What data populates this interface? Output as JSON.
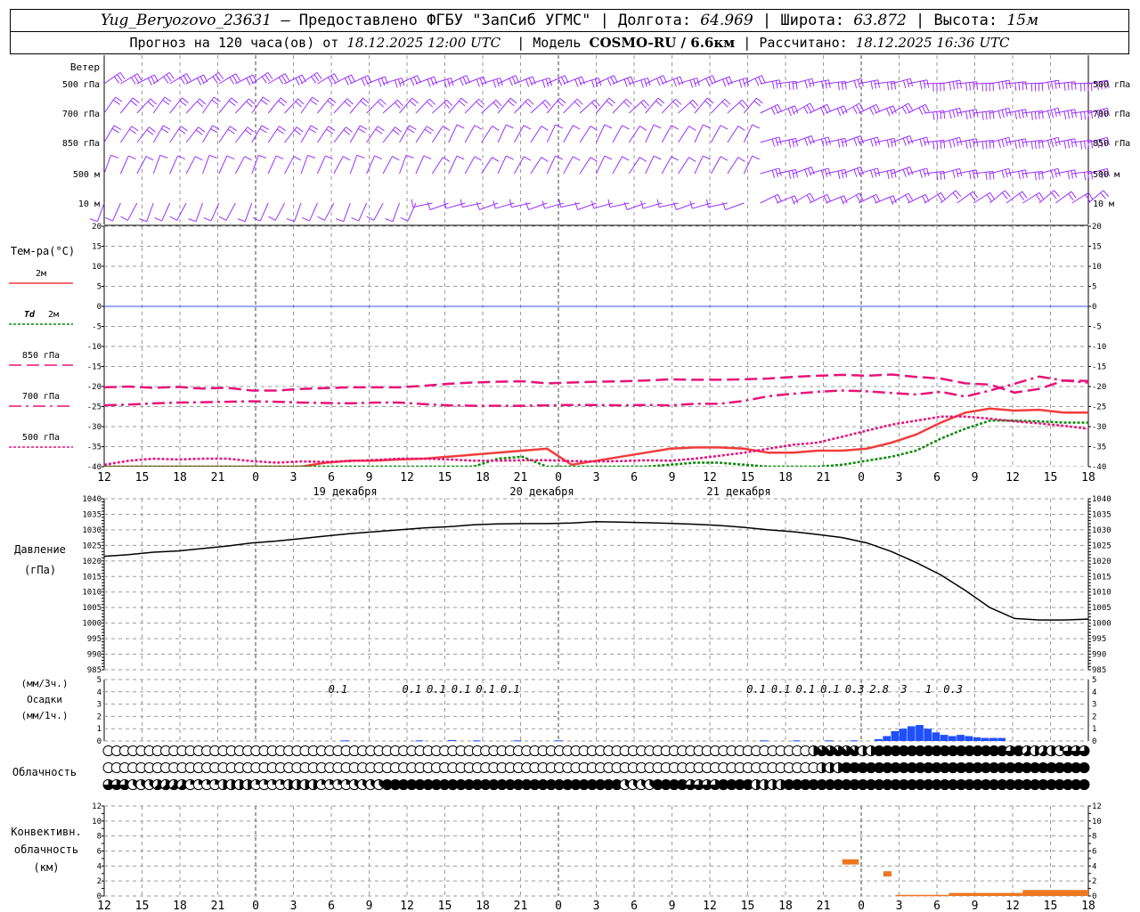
{
  "header": {
    "station": "Yug_Beryozovo_23631",
    "provider": "– Предоставлено ФГБУ \"ЗапСиб УГМС\"",
    "lon_label": "Долгота:",
    "lon": "64.969",
    "lat_label": "Широта:",
    "lat": "63.872",
    "alt_label": "Высота:",
    "alt": "15м",
    "forecast_label": "Прогноз на 120 часа(ов) от",
    "forecast_start": "18.12.2025 12:00 UTC",
    "model_label": "Модель",
    "model": "COSMO-RU / 6.6км",
    "calc_label": "Рассчитано:",
    "calc_time": "18.12.2025 16:36 UTC"
  },
  "colors": {
    "wind": "#9b30ff",
    "t2m": "#f23c3c",
    "td2m": "#0a8a0a",
    "t850": "#e8127a",
    "t700": "#e8127a",
    "t500": "#e8127a",
    "zero_line": "#3355ff",
    "pressure": "#000000",
    "precip": "#1f4fff",
    "convective": "#ee7722",
    "grid": "#9a9a9a"
  },
  "x_axis": {
    "ticks": [
      "12",
      "15",
      "18",
      "21",
      "0",
      "3",
      "6",
      "9",
      "12",
      "15",
      "18",
      "21",
      "0",
      "3",
      "6",
      "9",
      "12",
      "15",
      "18",
      "21",
      "0",
      "3",
      "6",
      "9",
      "12",
      "15",
      "18"
    ],
    "days": [
      "19 декабря",
      "20 декабря",
      "21 декабря"
    ]
  },
  "panels": {
    "wind": {
      "title": "Ветер",
      "levels": [
        "500 гПа",
        "700 гПа",
        "850 гПа",
        "500 м",
        "10 м"
      ]
    },
    "temp": {
      "title": "Тем-ра(°C)",
      "legend": [
        {
          "prefix": "",
          "label": "2м"
        },
        {
          "prefix": "Td",
          "label": "2м"
        },
        {
          "prefix": "",
          "label": "850 гПа"
        },
        {
          "prefix": "",
          "label": "700 гПа"
        },
        {
          "prefix": "",
          "label": "500 гПа"
        }
      ]
    },
    "pressure": {
      "title": "Давление",
      "unit": "(гПа)"
    },
    "precip": {
      "unit3": "(мм/3ч.)",
      "title": "Осадки",
      "unit1": "(мм/1ч.)"
    },
    "cloud": {
      "title": "Облачность"
    },
    "convective": {
      "title1": "Конвективн.",
      "title2": "облачность",
      "unit": "(км)"
    }
  },
  "chart_data": [
    {
      "type": "line",
      "name": "temperature",
      "x_hours": [
        0,
        3,
        6,
        9,
        12,
        15,
        18,
        21,
        24,
        27,
        30,
        33,
        36,
        39,
        42,
        45,
        48,
        51,
        54,
        57,
        60,
        63,
        66,
        69,
        72,
        75,
        78,
        81,
        84,
        87,
        90,
        93,
        96,
        99,
        102,
        105,
        108,
        111,
        114,
        117,
        120
      ],
      "ylim": [
        -40,
        20
      ],
      "yticks": [
        20,
        15,
        10,
        5,
        0,
        -5,
        -10,
        -15,
        -20,
        -25,
        -30,
        -35,
        -40
      ],
      "series": [
        {
          "key": "t2m",
          "values": [
            -42,
            -42,
            -42,
            -42,
            -42,
            -42,
            -41.5,
            -41,
            -40,
            -39,
            -38.5,
            -38.5,
            -38.2,
            -38,
            -37.5,
            -37,
            -36.5,
            -36,
            -35.5,
            -39.5,
            -38.5,
            -37.5,
            -36.5,
            -35.5,
            -35.2,
            -35.2,
            -35.5,
            -36.5,
            -36.5,
            -36,
            -36,
            -35.5,
            -34,
            -32,
            -29,
            -26.5,
            -25.5,
            -26,
            -25.8,
            -26.5,
            -26.5
          ]
        },
        {
          "key": "td2m",
          "values": [
            -44,
            -44,
            -44,
            -44,
            -44,
            -44,
            -44,
            -44,
            -44,
            -44,
            -44,
            -44,
            -44,
            -44,
            -43,
            -40,
            -38,
            -37.5,
            -40,
            -44,
            -44,
            -44,
            -41,
            -39.5,
            -39,
            -39,
            -39.5,
            -40,
            -40,
            -40,
            -39.5,
            -38.5,
            -37.5,
            -36,
            -33,
            -30.5,
            -28.5,
            -28.5,
            -28.7,
            -29,
            -29
          ]
        },
        {
          "key": "t850",
          "values": [
            -20.2,
            -20,
            -20.3,
            -20.1,
            -20.5,
            -20.3,
            -21,
            -21,
            -20.6,
            -20.4,
            -20.2,
            -20.2,
            -20.2,
            -19.8,
            -19.3,
            -19.0,
            -18.8,
            -18.7,
            -19.2,
            -19.0,
            -18.8,
            -18.7,
            -18.5,
            -18.2,
            -18.3,
            -18.3,
            -18.2,
            -18.0,
            -17.6,
            -17.3,
            -17.1,
            -17.3,
            -17.0,
            -17.6,
            -18,
            -19.2,
            -19.5,
            -21.5,
            -20.6,
            -18.5,
            -18.6
          ]
        },
        {
          "key": "t700",
          "values": [
            -24.7,
            -24.5,
            -24.2,
            -24,
            -23.9,
            -23.8,
            -23.7,
            -23.8,
            -24,
            -24.1,
            -24.2,
            -24.0,
            -24.0,
            -24.4,
            -24.7,
            -24.8,
            -24.8,
            -24.8,
            -24.7,
            -24.6,
            -24.6,
            -24.7,
            -24.6,
            -24.7,
            -24.3,
            -24.3,
            -23.6,
            -22.4,
            -21.8,
            -21.3,
            -21.0,
            -21.2,
            -21.6,
            -22.0,
            -21.3,
            -22.5,
            -21.0,
            -19.3,
            -17.5,
            -18.5,
            -19.0
          ]
        },
        {
          "key": "t500",
          "values": [
            -39.5,
            -38.5,
            -38,
            -38.2,
            -38,
            -38,
            -38.6,
            -39,
            -38.7,
            -38.8,
            -38.6,
            -38.3,
            -38.0,
            -38.0,
            -38.2,
            -38.5,
            -38.5,
            -38.4,
            -38.4,
            -38.6,
            -38.7,
            -38.6,
            -38.4,
            -38.5,
            -38.0,
            -37.3,
            -36.5,
            -35.5,
            -34.5,
            -34,
            -32.5,
            -31,
            -29.5,
            -28.5,
            -27.5,
            -27.5,
            -28,
            -28.7,
            -29.2,
            -29.8,
            -30.5
          ]
        }
      ]
    },
    {
      "type": "line",
      "name": "pressure",
      "x_hours": [
        0,
        3,
        6,
        9,
        12,
        15,
        18,
        21,
        24,
        27,
        30,
        33,
        36,
        39,
        42,
        45,
        48,
        51,
        54,
        57,
        60,
        63,
        66,
        69,
        72,
        75,
        78,
        81,
        84,
        87,
        90,
        93,
        96,
        99,
        102,
        105,
        108,
        111,
        114,
        117,
        120
      ],
      "ylim": [
        985,
        1040
      ],
      "yticks": [
        1040,
        1035,
        1030,
        1025,
        1020,
        1015,
        1010,
        1005,
        1000,
        995,
        990,
        985
      ],
      "values": [
        1021.5,
        1022,
        1022.8,
        1023.2,
        1024,
        1024.8,
        1025.8,
        1026.4,
        1027.2,
        1028,
        1028.8,
        1029.4,
        1030,
        1030.6,
        1031,
        1031.6,
        1031.9,
        1032,
        1032,
        1032.2,
        1032.6,
        1032.5,
        1032.3,
        1032.1,
        1031.8,
        1031.4,
        1030.8,
        1030,
        1029.4,
        1028.5,
        1027.5,
        1025.8,
        1023,
        1019.5,
        1015.5,
        1010.5,
        1005,
        1001.5,
        1001,
        1001,
        1001.3
      ]
    },
    {
      "type": "bar",
      "name": "precipitation",
      "ylim": [
        0,
        5
      ],
      "yticks": [
        5,
        4,
        3,
        2,
        1,
        0
      ],
      "labels_3h": [
        {
          "h": 30,
          "v": "0.1"
        },
        {
          "h": 39,
          "v": "0.1"
        },
        {
          "h": 42,
          "v": "0.1"
        },
        {
          "h": 45,
          "v": "0.1"
        },
        {
          "h": 48,
          "v": "0.1"
        },
        {
          "h": 51,
          "v": "0.1"
        },
        {
          "h": 81,
          "v": "0.1"
        },
        {
          "h": 84,
          "v": "0.1"
        },
        {
          "h": 87,
          "v": "0.1"
        },
        {
          "h": 90,
          "v": "0.1"
        },
        {
          "h": 93,
          "v": "0.3"
        },
        {
          "h": 96,
          "v": "2.8"
        },
        {
          "h": 99,
          "v": "3"
        },
        {
          "h": 102,
          "v": "1"
        },
        {
          "h": 105,
          "v": "0.3"
        }
      ],
      "hourly": [
        {
          "h": 29,
          "v": 0.05
        },
        {
          "h": 38,
          "v": 0.05
        },
        {
          "h": 42,
          "v": 0.08
        },
        {
          "h": 45,
          "v": 0.05
        },
        {
          "h": 50,
          "v": 0.05
        },
        {
          "h": 55,
          "v": 0.05
        },
        {
          "h": 80,
          "v": 0.05
        },
        {
          "h": 84,
          "v": 0.05
        },
        {
          "h": 88,
          "v": 0.05
        },
        {
          "h": 91,
          "v": 0.05
        },
        {
          "h": 94,
          "v": 0.15
        },
        {
          "h": 95,
          "v": 0.4
        },
        {
          "h": 96,
          "v": 0.8
        },
        {
          "h": 97,
          "v": 1.0
        },
        {
          "h": 98,
          "v": 1.2
        },
        {
          "h": 99,
          "v": 1.3
        },
        {
          "h": 100,
          "v": 1.0
        },
        {
          "h": 101,
          "v": 0.7
        },
        {
          "h": 102,
          "v": 0.5
        },
        {
          "h": 103,
          "v": 0.4
        },
        {
          "h": 104,
          "v": 0.5
        },
        {
          "h": 105,
          "v": 0.4
        },
        {
          "h": 106,
          "v": 0.3
        },
        {
          "h": 107,
          "v": 0.25
        },
        {
          "h": 108,
          "v": 0.25
        },
        {
          "h": 109,
          "v": 0.25
        }
      ]
    },
    {
      "type": "bar",
      "name": "convective_cloud",
      "ylim": [
        0,
        12
      ],
      "yticks": [
        12,
        10,
        8,
        6,
        4,
        2,
        0
      ],
      "bars": [
        {
          "h0": 90,
          "h1": 92,
          "bottom": 4.2,
          "top": 4.9
        },
        {
          "h0": 95,
          "h1": 96,
          "bottom": 2.6,
          "top": 3.3
        },
        {
          "h0": 96.5,
          "h1": 103,
          "bottom": 0,
          "top": 0.15
        },
        {
          "h0": 103,
          "h1": 112,
          "bottom": 0,
          "top": 0.4
        },
        {
          "h0": 112,
          "h1": 120,
          "bottom": 0,
          "top": 0.8
        }
      ]
    },
    {
      "type": "table",
      "name": "cloud_cover",
      "rows_note": "upper, middle, lower layers; 0..8 octas per hour",
      "upper_segments": [
        [
          0,
          86,
          0
        ],
        [
          86,
          87,
          4
        ],
        [
          87,
          92,
          7
        ],
        [
          92,
          94,
          4
        ],
        [
          94,
          110,
          8
        ],
        [
          110,
          111,
          6
        ],
        [
          111,
          112,
          8
        ],
        [
          112,
          113,
          5
        ],
        [
          113,
          114,
          4
        ],
        [
          114,
          115,
          5
        ],
        [
          115,
          116,
          4
        ],
        [
          116,
          117,
          2
        ],
        [
          117,
          120,
          6
        ]
      ],
      "middle_segments": [
        [
          0,
          87,
          0
        ],
        [
          87,
          90,
          4
        ],
        [
          90,
          120,
          8
        ]
      ],
      "lower_segments": [
        [
          0,
          3,
          6
        ],
        [
          3,
          6,
          3
        ],
        [
          6,
          10,
          5
        ],
        [
          10,
          14,
          2
        ],
        [
          14,
          18,
          4
        ],
        [
          18,
          22,
          2
        ],
        [
          22,
          26,
          4
        ],
        [
          26,
          30,
          2
        ],
        [
          30,
          34,
          3
        ],
        [
          34,
          63,
          8
        ],
        [
          63,
          67,
          3
        ],
        [
          67,
          71,
          8
        ],
        [
          71,
          75,
          6
        ],
        [
          75,
          79,
          8
        ],
        [
          79,
          83,
          4
        ],
        [
          83,
          120,
          8
        ]
      ]
    },
    {
      "type": "table",
      "name": "wind_barbs",
      "rows": [
        {
          "level": "500 гПа",
          "segments": [
            [
              0,
              30,
              55,
              25
            ],
            [
              30,
              80,
              65,
              25
            ],
            [
              80,
              100,
              75,
              30
            ],
            [
              100,
              120,
              80,
              45
            ]
          ]
        },
        {
          "level": "700 гПа",
          "segments": [
            [
              0,
              30,
              35,
              20
            ],
            [
              30,
              80,
              40,
              20
            ],
            [
              80,
              100,
              60,
              25
            ],
            [
              100,
              120,
              75,
              35
            ]
          ]
        },
        {
          "level": "850 гПа",
          "segments": [
            [
              0,
              40,
              30,
              15
            ],
            [
              40,
              80,
              25,
              10
            ],
            [
              80,
              100,
              70,
              25
            ],
            [
              100,
              120,
              75,
              35
            ]
          ]
        },
        {
          "level": "500 м",
          "segments": [
            [
              0,
              40,
              20,
              10
            ],
            [
              40,
              80,
              25,
              10
            ],
            [
              80,
              100,
              70,
              25
            ],
            [
              100,
              120,
              75,
              30
            ]
          ]
        },
        {
          "level": "10 м",
          "segments": [
            [
              0,
              40,
              200,
              5
            ],
            [
              40,
              80,
              250,
              5
            ],
            [
              80,
              100,
              60,
              15
            ],
            [
              100,
              120,
              50,
              15
            ]
          ]
        }
      ]
    }
  ]
}
